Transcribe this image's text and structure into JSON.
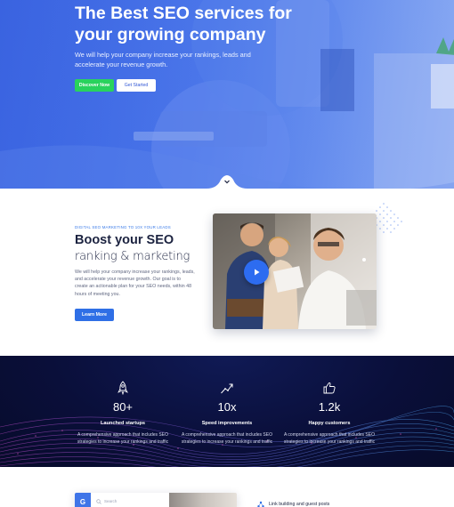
{
  "hero": {
    "title": "The Best SEO services for your growing company",
    "lead": "We will help your company increase your rankings, leads and accelerate your revenue growth.",
    "discover_label": "Discover Now",
    "get_started_label": "Get Started"
  },
  "boost": {
    "tagline": "DIGITAL SEO MARKETING TO 10X YOUR LEADS",
    "title": "Boost your SEO",
    "subtitle": "ranking & marketing",
    "body": "We will help your company increase your rankings, leads, and accelerate your revenue growth. Our goal is to create an actionable plan for your SEO needs, within 48 hours of meeting you.",
    "learn_label": "Learn More"
  },
  "stats": [
    {
      "icon": "rocket-icon",
      "value": "80+",
      "label": "Launched startups",
      "desc": "A comprehensive approach that includes SEO strategies to increase your rankings and traffic"
    },
    {
      "icon": "growth-chart-icon",
      "value": "10x",
      "label": "Speed improvements",
      "desc": "A comprehensive approach that includes SEO strategies to increase your rankings and traffic"
    },
    {
      "icon": "thumbs-up-icon",
      "value": "1.2k",
      "label": "Happy customers",
      "desc": "A comprehensive approach that includes SEO strategies to increase your rankings and traffic"
    }
  ],
  "bottom": {
    "search_badge": "G",
    "search_placeholder": "Search",
    "link_item": "Link building and guest posts"
  },
  "colors": {
    "hero_blue": "#4673ea",
    "cta_green": "#29d25d",
    "accent_blue": "#2f6fe6",
    "stats_navy": "#0a0f3a"
  }
}
